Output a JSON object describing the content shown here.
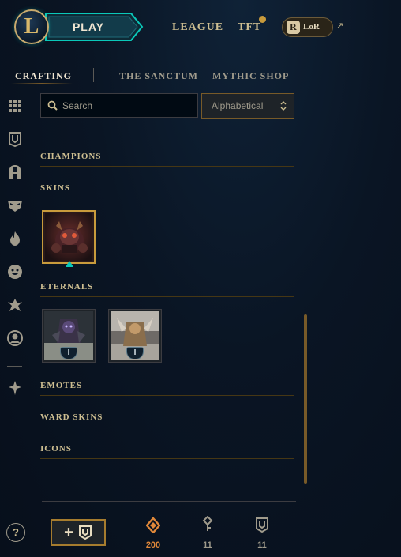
{
  "header": {
    "play_label": "PLAY",
    "nav": [
      {
        "label": "LEAGUE"
      },
      {
        "label": "TFT",
        "has_notification": true
      }
    ],
    "lor": {
      "icon_letter": "R",
      "label": "LoR",
      "external_icon": "external-link-icon"
    }
  },
  "subtabs": [
    {
      "label": "CRAFTING",
      "active": true
    },
    {
      "label": "THE SANCTUM",
      "active": false
    },
    {
      "label": "MYTHIC SHOP",
      "active": false
    }
  ],
  "sidebar": {
    "icons": [
      "grid-icon",
      "chest-icon",
      "champion-helmet-icon",
      "skin-mask-icon",
      "ward-flame-icon",
      "emote-smile-icon",
      "summoner-icon-icon",
      "profile-icon",
      "eternals-icon"
    ]
  },
  "search": {
    "placeholder": "Search",
    "value": ""
  },
  "sort": {
    "selected": "Alphabetical"
  },
  "sections": {
    "champions": "CHAMPIONS",
    "skins": "SKINS",
    "eternals": "ETERNALS",
    "emotes": "EMOTES",
    "ward_skins": "WARD SKINS",
    "icons": "ICONS"
  },
  "eternals": [
    {
      "badge": "I"
    },
    {
      "badge": "I"
    }
  ],
  "footer": {
    "help_label": "?",
    "add_button_plus": "+",
    "currencies": [
      {
        "icon": "orange-essence-icon",
        "value": "200",
        "color": "#e0883a"
      },
      {
        "icon": "key-fragment-icon",
        "value": "11",
        "color": "#a09b8c"
      },
      {
        "icon": "chest-icon",
        "value": "11",
        "color": "#a09b8c"
      }
    ]
  },
  "colors": {
    "gold": "#c89b3c",
    "gold_text": "#cdbe91",
    "teal_accent": "#0ac8b9",
    "background": "#0a1524"
  }
}
